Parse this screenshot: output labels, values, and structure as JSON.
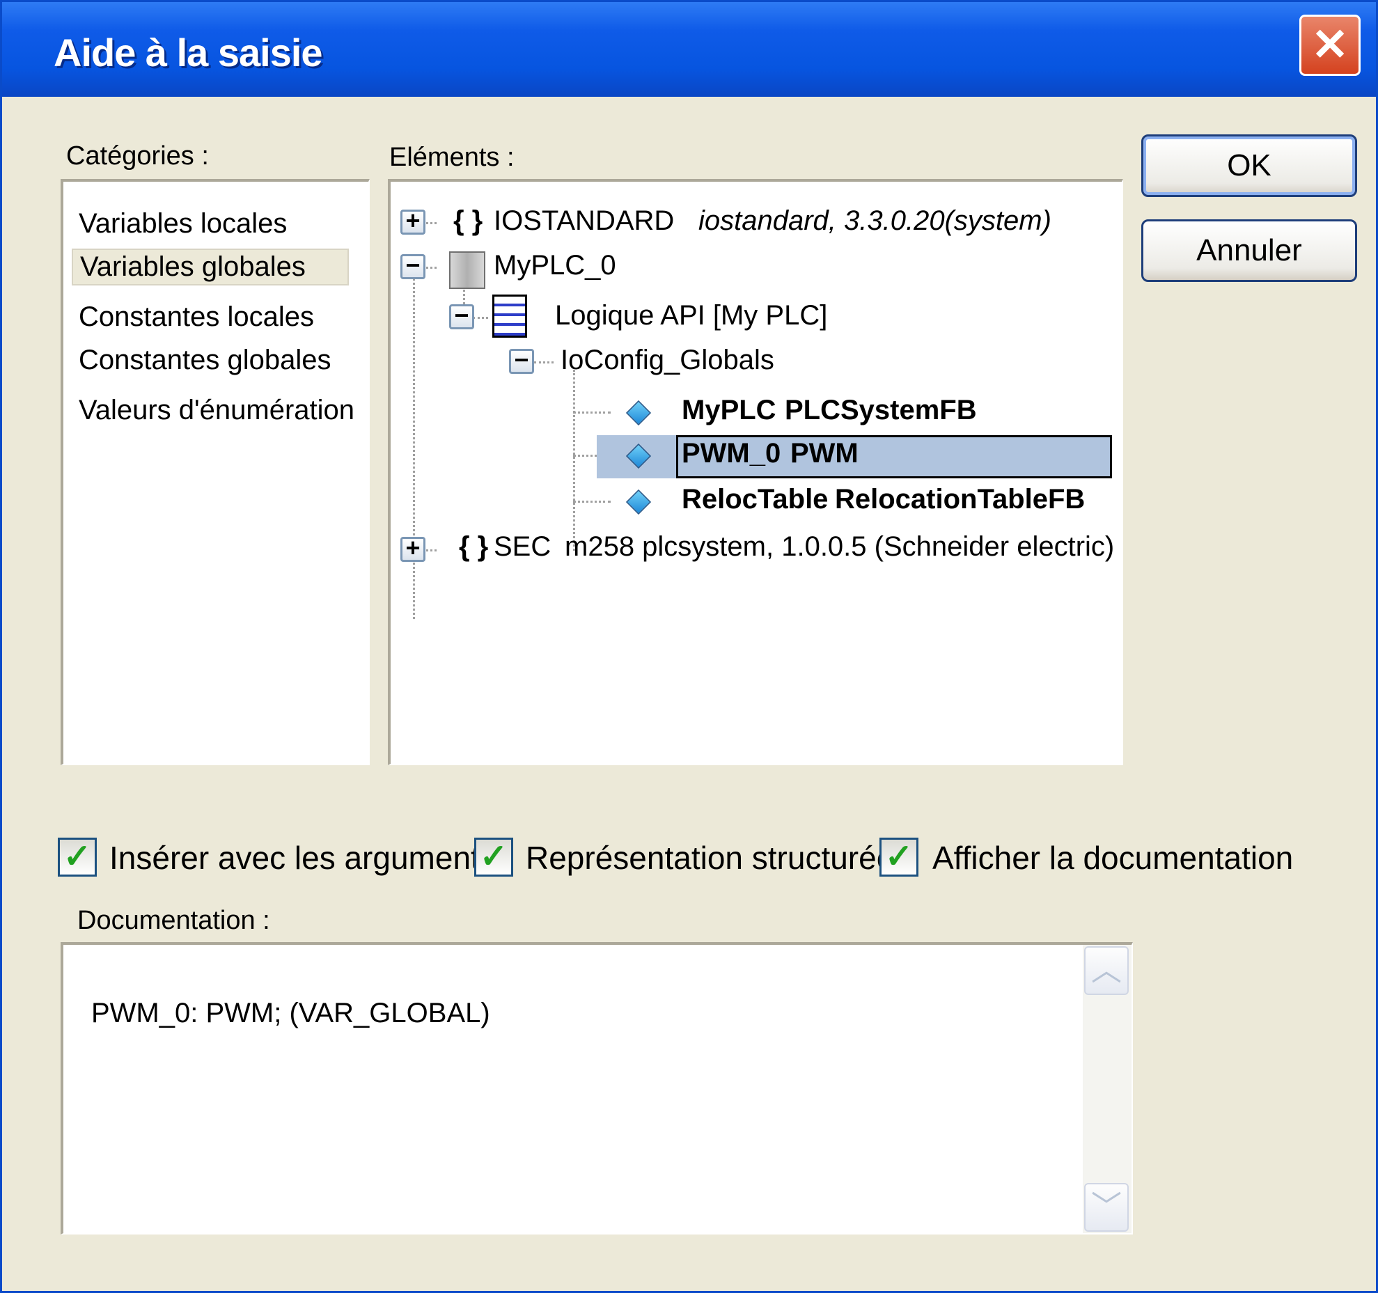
{
  "window": {
    "title": "Aide à la saisie",
    "close_glyph": "✕"
  },
  "categories": {
    "label": "Catégories :",
    "items": [
      "Variables locales",
      "Variables globales",
      "Constantes locales",
      "Constantes globales",
      "Valeurs d'énumération"
    ],
    "selected": "Variables globales"
  },
  "elements": {
    "label": "Eléments :",
    "tree": [
      {
        "name": "IOSTANDARD",
        "detail": "iostandard, 3.3.0.20(system)",
        "icon": "braces-icon",
        "expander": "+"
      },
      {
        "name": "MyPLC_0",
        "icon": "plc-icon",
        "expander": "−"
      },
      {
        "name": "Logique API [My PLC]",
        "icon": "document-icon",
        "expander": "−"
      },
      {
        "name": "IoConfig_Globals",
        "expander": "−"
      },
      {
        "name": "MyPLC",
        "type": "PLCSystemFB",
        "icon": "function-block-icon"
      },
      {
        "name": "PWM_0",
        "type": "PWM",
        "icon": "function-block-icon",
        "selected": true
      },
      {
        "name": "RelocTable",
        "type": "RelocationTableFB",
        "icon": "function-block-icon"
      },
      {
        "name": "SEC",
        "detail": "m258 plcsystem, 1.0.0.5 (Schneider electric)",
        "icon": "braces-icon",
        "expander": "+"
      }
    ],
    "braces_glyph": "{ }"
  },
  "buttons": {
    "ok": "OK",
    "cancel": "Annuler"
  },
  "options": [
    {
      "label": "Insérer avec les arguments",
      "checked": true
    },
    {
      "label": "Représentation structurée",
      "checked": true
    },
    {
      "label": "Afficher la documentation",
      "checked": true
    }
  ],
  "check_glyph": "✓",
  "documentation": {
    "label": "Documentation :",
    "text": "PWM_0: PWM; (VAR_GLOBAL)",
    "scroll_up_glyph": "︿",
    "scroll_down_glyph": "﹀"
  },
  "colors": {
    "titlebar": "#0755E0",
    "dialog_bg": "#ECE9D8",
    "selection": "#B0C4DE",
    "check": "#21A121"
  }
}
